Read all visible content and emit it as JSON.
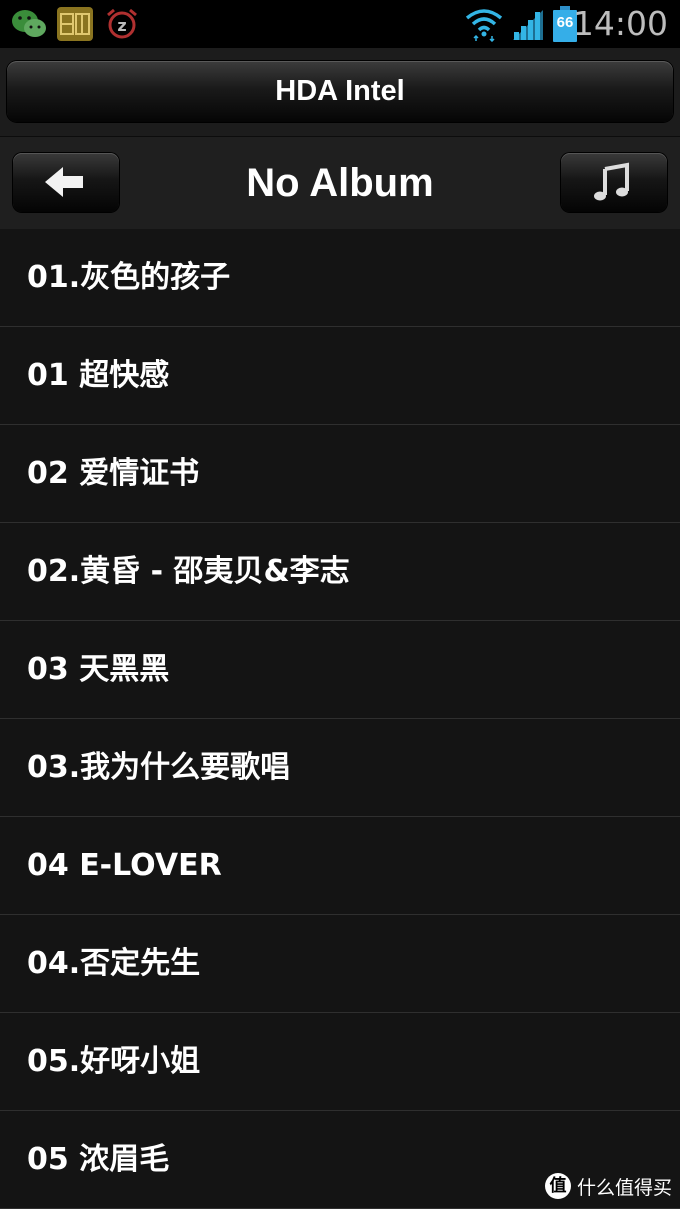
{
  "status_bar": {
    "left_icons": [
      "wechat-icon",
      "app-badge-icon",
      "alarm-clock-icon"
    ],
    "right_icons": [
      "wifi-icon",
      "signal-bars-icon",
      "battery-icon"
    ],
    "battery_level": "66",
    "time": "14:00"
  },
  "device_header": {
    "title": "HDA Intel"
  },
  "album_header": {
    "back_icon": "back-arrow-icon",
    "title": "No Album",
    "music_icon": "music-note-icon"
  },
  "songs": [
    {
      "label": "01.灰色的孩子"
    },
    {
      "label": "01 超快感"
    },
    {
      "label": "02 爱情证书"
    },
    {
      "label": "02.黄昏 - 邵夷贝&李志"
    },
    {
      "label": "03 天黑黑"
    },
    {
      "label": "03.我为什么要歌唱"
    },
    {
      "label": "04 E-LOVER"
    },
    {
      "label": "04.否定先生"
    },
    {
      "label": "05.好呀小姐"
    },
    {
      "label": "05 浓眉毛"
    }
  ],
  "watermark": {
    "badge": "值",
    "text": "什么值得买"
  },
  "colors": {
    "background": "#141414",
    "divider": "#2f2f2f",
    "battery": "#35aee8",
    "wifi": "#33b5e5",
    "text": "#ffffff"
  }
}
